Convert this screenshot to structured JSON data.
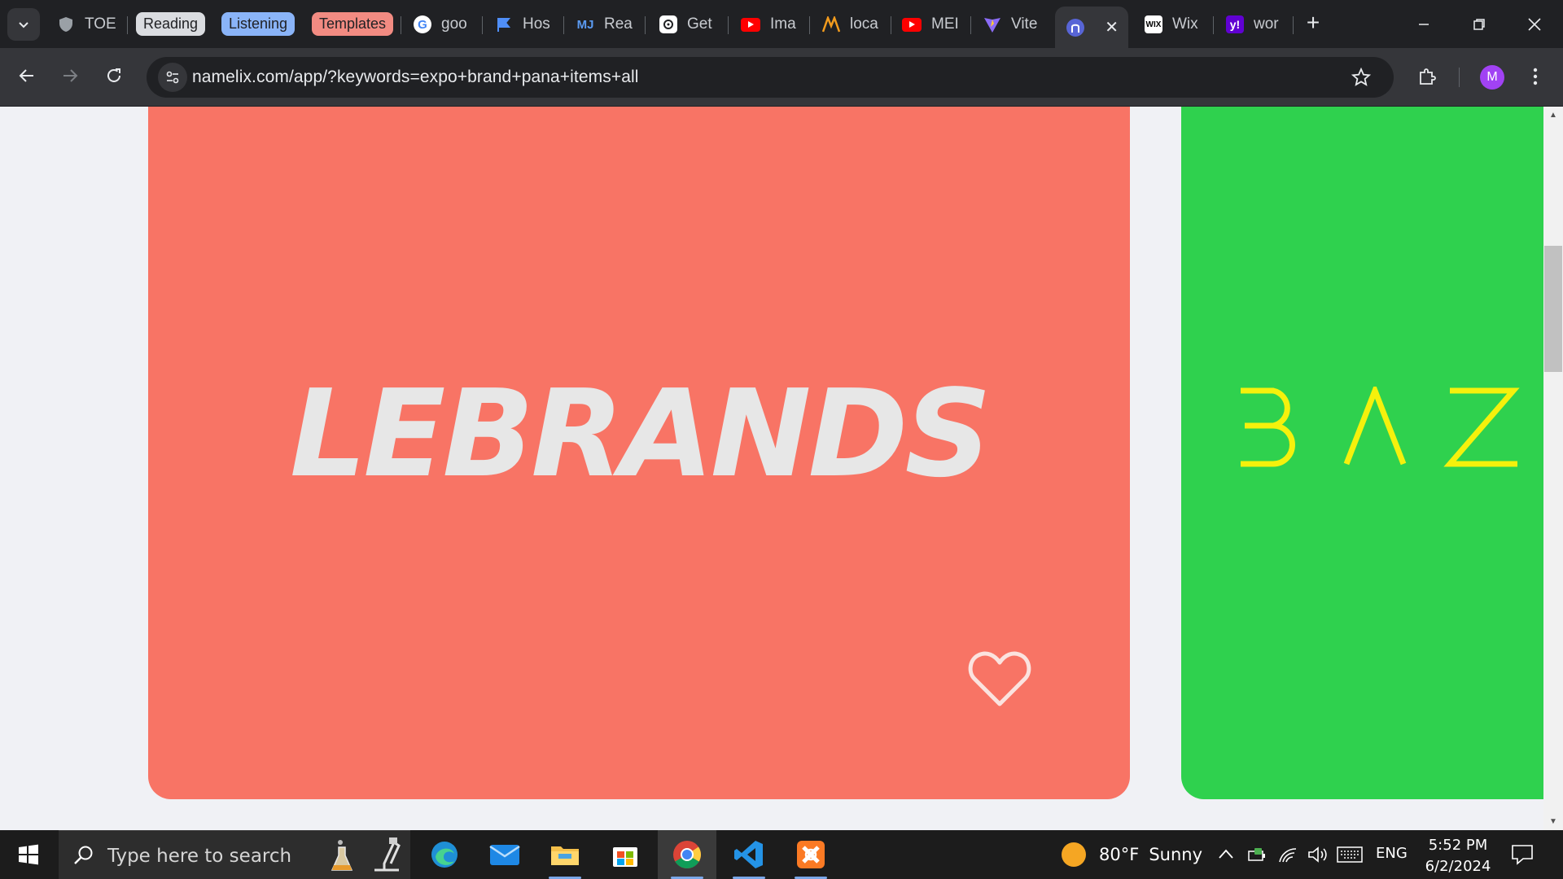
{
  "browser": {
    "tabs": [
      {
        "title": "TOE",
        "icon": "shield-icon"
      },
      {
        "title": "goo",
        "icon": "google-icon"
      },
      {
        "title": "Hos",
        "icon": "flag-icon"
      },
      {
        "title": "Rea",
        "icon": "mj-icon"
      },
      {
        "title": "Get",
        "icon": "openai-icon"
      },
      {
        "title": "Ima",
        "icon": "youtube-icon"
      },
      {
        "title": "loca",
        "icon": "xampp-icon"
      },
      {
        "title": "MEI",
        "icon": "youtube-icon"
      },
      {
        "title": "Vite",
        "icon": "vite-icon"
      },
      {
        "title": "",
        "icon": "namelix-icon",
        "active": true
      },
      {
        "title": "Wix",
        "icon": "wix-icon"
      },
      {
        "title": "wor",
        "icon": "yahoo-icon"
      }
    ],
    "groups": [
      {
        "label": "Reading",
        "color": "#dadce0"
      },
      {
        "label": "Listening",
        "color": "#8ab4f8"
      },
      {
        "label": "Templates",
        "color": "#f28b82"
      }
    ],
    "url": "namelix.com/app/?keywords=expo+brand+pana+items+all",
    "profile_initial": "M"
  },
  "page": {
    "cards": [
      {
        "name": "LEBRANDS",
        "background": "#f87465",
        "text_color": "#e7e7e7"
      },
      {
        "name": "BAZ",
        "background": "#2fd14e",
        "text_color": "#f5f10c"
      }
    ]
  },
  "taskbar": {
    "search_placeholder": "Type here to search",
    "weather_temp": "80°F",
    "weather_text": "Sunny",
    "language": "ENG",
    "time": "5:52 PM",
    "date": "6/2/2024"
  }
}
